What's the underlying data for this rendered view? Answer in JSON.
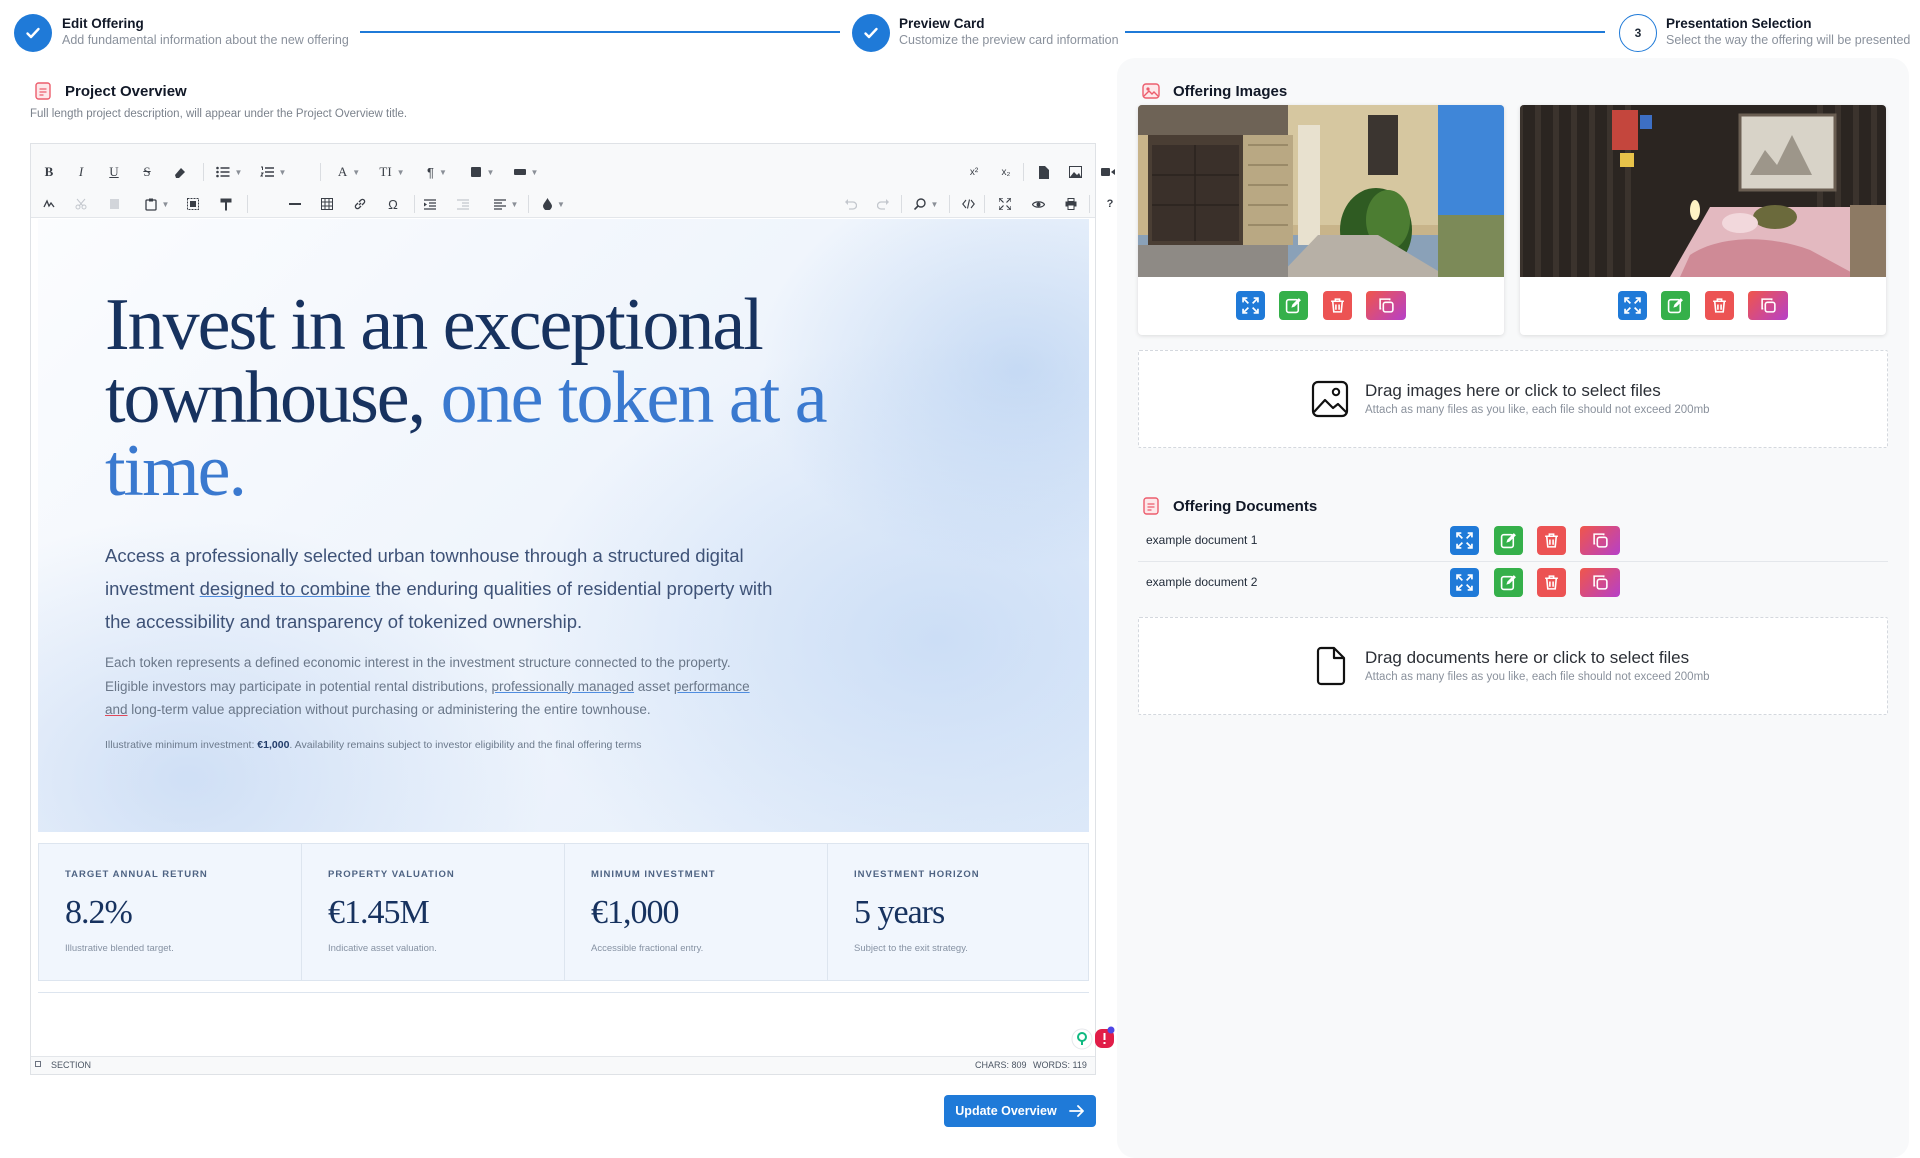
{
  "stepper": {
    "steps": [
      {
        "title": "Edit Offering",
        "subtitle": "Add fundamental information about the new offering",
        "state": "done"
      },
      {
        "title": "Preview Card",
        "subtitle": "Customize the preview card information",
        "state": "done"
      },
      {
        "title": "Presentation Selection",
        "subtitle": "Select the way the offering will be presented",
        "state": "current",
        "number": "3"
      }
    ],
    "accent": "#1f7ad8"
  },
  "overview": {
    "title": "Project Overview",
    "description": "Full length project description, will appear under the Project Overview title."
  },
  "editor": {
    "toolbar_row1": {
      "bold": "B",
      "italic": "I",
      "underline": "U",
      "strike": "S",
      "font_color": "A",
      "font_size": "TI",
      "paragraph": "¶",
      "superscript": "x²",
      "subscript": "x₂"
    },
    "toolbar_row2": {
      "special_char": "Ω",
      "help": "?"
    },
    "hero": {
      "headline_part1": "Invest in an exceptional townhouse, ",
      "headline_part2": "one token at a time.",
      "lead_a": "Access a professionally selected urban townhouse through a structured digital investment ",
      "lead_link": "designed to combine",
      "lead_b": " the enduring qualities of residential property with the accessibility and transparency of tokenized ownership.",
      "body_a": "Each token represents a defined economic interest in the investment structure connected to the property. Eligible investors may participate in potential rental distributions, ",
      "body_u1": "professionally managed",
      "body_b": " asset ",
      "body_u2": "performance",
      "body_c": " ",
      "body_u3": "and",
      "body_d": " long-term value appreciation without purchasing or administering the entire townhouse.",
      "note_a": "Illustrative minimum investment: ",
      "note_b": "€1,000",
      "note_c": ". Availability remains subject to investor eligibility and the final offering terms"
    },
    "stats": [
      {
        "label": "TARGET ANNUAL RETURN",
        "value": "8.2%",
        "sub": "Illustrative blended target."
      },
      {
        "label": "PROPERTY VALUATION",
        "value": "€1.45M",
        "sub": "Indicative asset valuation."
      },
      {
        "label": "MINIMUM INVESTMENT",
        "value": "€1,000",
        "sub": "Accessible fractional entry."
      },
      {
        "label": "INVESTMENT HORIZON",
        "value": "5 years",
        "sub": "Subject to the exit strategy."
      }
    ],
    "status": {
      "path": "SECTION",
      "chars": "CHARS: 809",
      "words": "WORDS: 119"
    }
  },
  "update_button": "Update Overview",
  "images": {
    "title": "Offering Images",
    "drop_title": "Drag images here or click to select files",
    "drop_sub": "Attach as many files as you like, each file should not exceed 200mb",
    "items": [
      {
        "alt": "townhouse exterior with garage"
      },
      {
        "alt": "bedroom with wooden walls"
      }
    ]
  },
  "documents": {
    "title": "Offering Documents",
    "items": [
      {
        "name": "example document 1"
      },
      {
        "name": "example document 2"
      }
    ],
    "drop_title": "Drag documents here or click to select files",
    "drop_sub": "Attach as many files as you like, each file should not exceed 200mb"
  }
}
